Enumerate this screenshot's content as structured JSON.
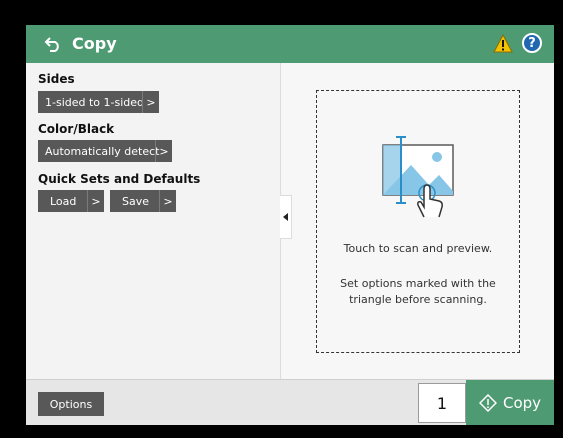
{
  "header": {
    "title": "Copy",
    "help_label": "?"
  },
  "settings": {
    "sides": {
      "label": "Sides",
      "value": "1-sided to 1-sided"
    },
    "color": {
      "label": "Color/Black",
      "value": "Automatically detect"
    },
    "quick_sets": {
      "label": "Quick Sets and Defaults",
      "load_label": "Load",
      "save_label": "Save"
    },
    "chevron": ">"
  },
  "preview": {
    "line1": "Touch to scan and preview.",
    "line2": "Set options marked with the",
    "line3": "triangle before scanning."
  },
  "footer": {
    "options_label": "Options",
    "copies_value": "1",
    "copy_label": "Copy"
  },
  "colors": {
    "accent": "#4e9a73",
    "button_gray": "#585858",
    "warning": "#f2c200",
    "help": "#1f67b1",
    "illustration": "#87c6e6"
  },
  "icons": [
    "back-arrow-icon",
    "warning-icon",
    "help-icon",
    "collapse-arrow-icon",
    "scan-preview-icon",
    "copy-start-icon"
  ]
}
